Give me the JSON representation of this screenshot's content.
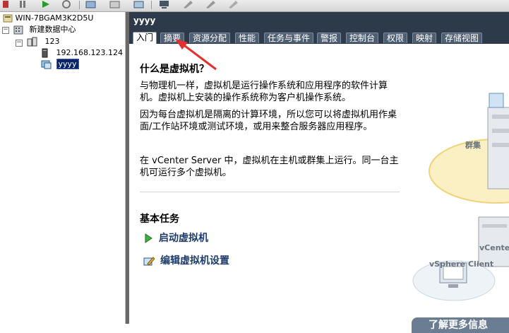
{
  "tree": {
    "host_root": "WIN-7BGAM3K2D5U",
    "datacenter": "新建数据中心",
    "cluster": "123",
    "host": "192.168.123.124",
    "vm": "yyyy",
    "expander_minus": "−"
  },
  "vm_title": "yyyy",
  "tabs": [
    "入门",
    "摘要",
    "资源分配",
    "性能",
    "任务与事件",
    "警报",
    "控制台",
    "权限",
    "映射",
    "存储视图"
  ],
  "content": {
    "heading": "什么是虚拟机？",
    "para1": "与物理机一样，虚拟机是运行操作系统和应用程序的软件计算机。虚拟机上安装的操作系统称为客户机操作系统。",
    "para2": "因为每台虚拟机是隔离的计算环境，所以您可以将虚拟机用作桌面/工作站环境或测试环境，或用来整合服务器应用程序。",
    "para3": "在 vCenter Server 中，虚拟机在主机或群集上运行。同一台主机可运行多个虚拟机。",
    "basic_tasks": "基本任务",
    "task_start": "启动虚拟机",
    "task_edit": "编辑虚拟机设置"
  },
  "illustration": {
    "cluster_label": "群集",
    "vcenter_label": "vCenter",
    "client_label": "vSphere Client"
  },
  "learn_more": "了解更多信息",
  "colors": {
    "title_bar": "#2d3a4a",
    "annotation_arrow": "#e53030",
    "task_text": "#1c3c6c"
  }
}
